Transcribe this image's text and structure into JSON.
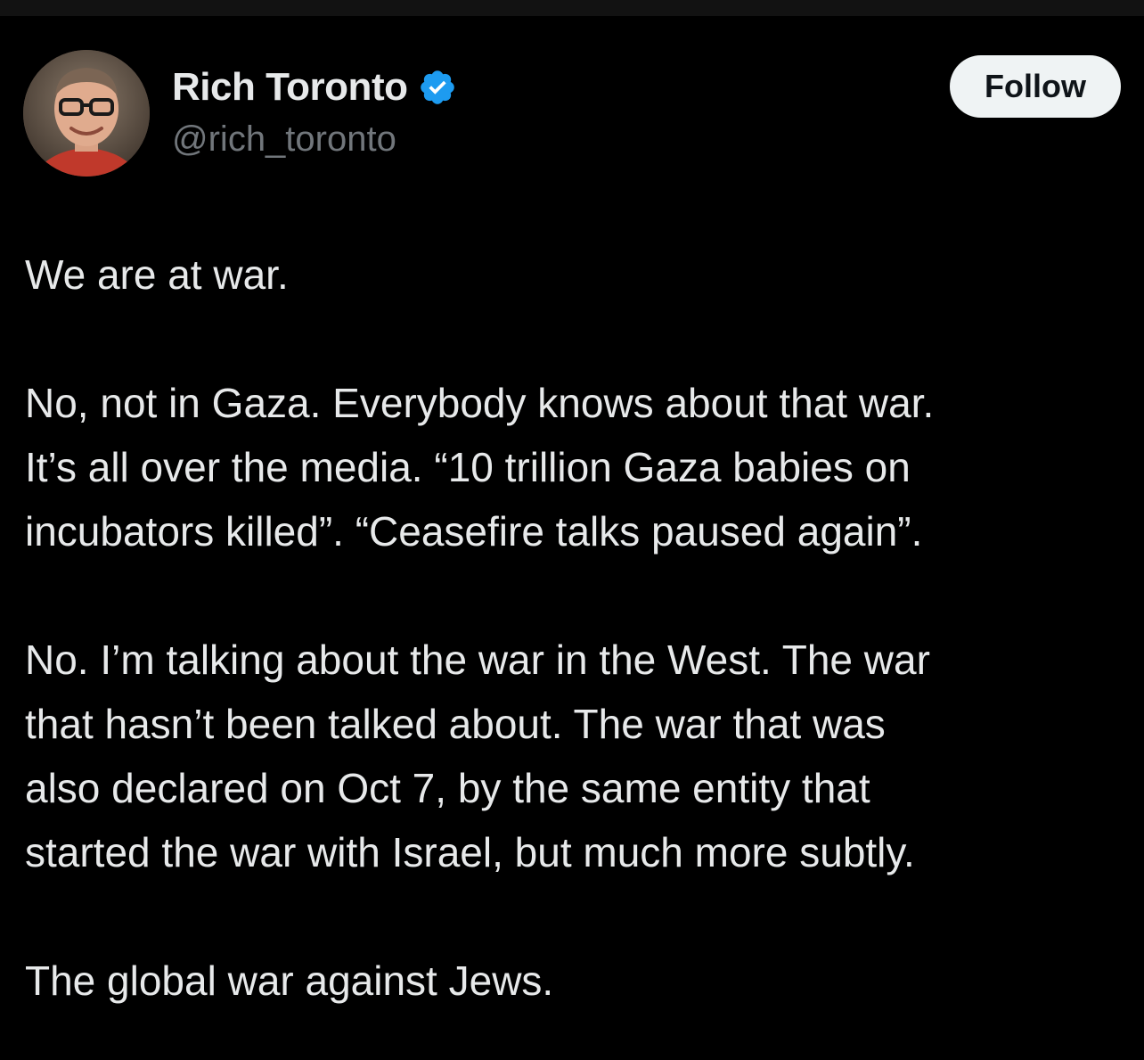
{
  "author": {
    "display_name": "Rich Toronto",
    "handle": "@rich_toronto",
    "verified": true,
    "avatar_icon": "profile-photo",
    "badge_color": "#1d9bf0"
  },
  "actions": {
    "follow_label": "Follow"
  },
  "tweet": {
    "paragraphs": [
      [
        "We are at war."
      ],
      [
        "No, not in Gaza.  Everybody knows about that war.",
        "It’s all over the media.  “10 trillion Gaza babies on",
        "incubators killed”.  “Ceasefire talks paused again”."
      ],
      [
        "No. I’m talking about the war in the West.  The war",
        "that hasn’t been talked about.  The war that was",
        "also declared on Oct 7, by the same entity that",
        "started the war with Israel, but much more subtly."
      ],
      [
        "The global war against Jews."
      ]
    ]
  },
  "colors": {
    "background": "#000000",
    "text": "#e7e9ea",
    "secondary_text": "#71767b",
    "button_bg": "#eff3f4"
  }
}
